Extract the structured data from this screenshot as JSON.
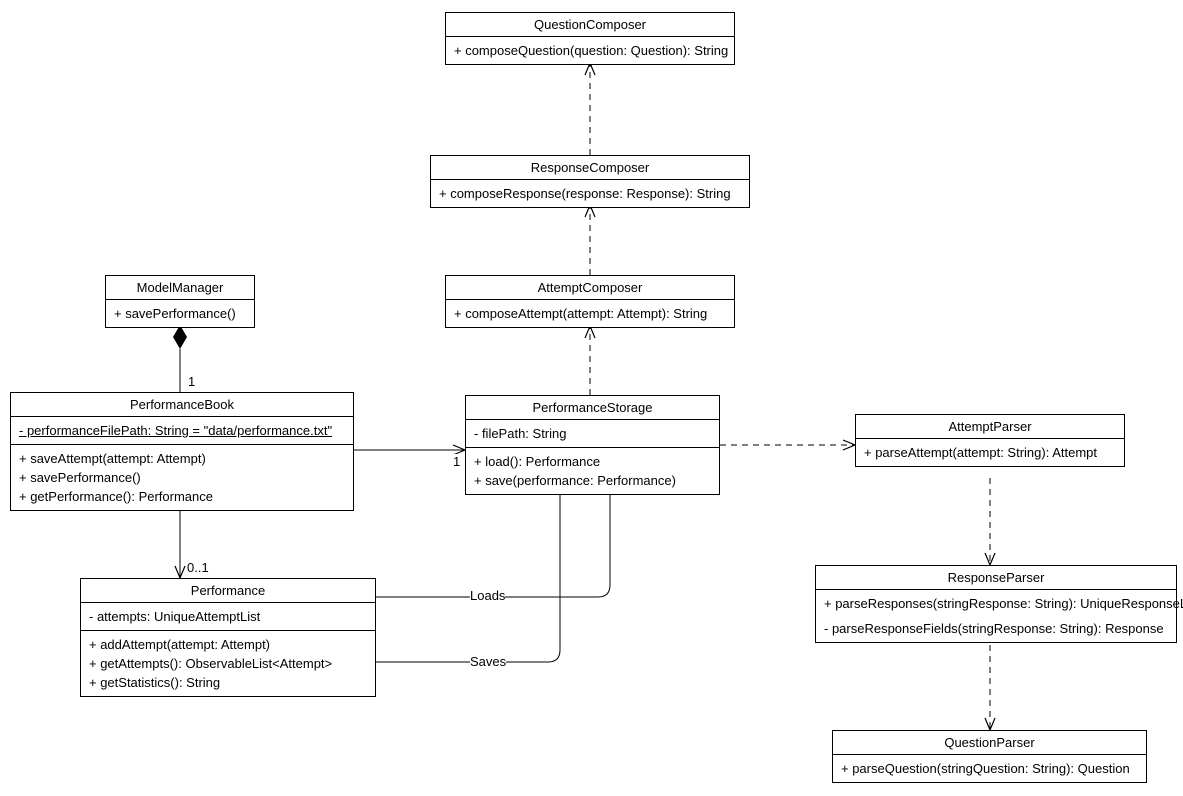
{
  "classes": {
    "question_composer": {
      "name": "QuestionComposer",
      "ops": [
        "+ composeQuestion(question: Question): String"
      ]
    },
    "response_composer": {
      "name": "ResponseComposer",
      "ops": [
        "+ composeResponse(response: Response): String"
      ]
    },
    "attempt_composer": {
      "name": "AttemptComposer",
      "ops": [
        "+ composeAttempt(attempt: Attempt): String"
      ]
    },
    "model_manager": {
      "name": "ModelManager",
      "ops": [
        "+ savePerformance()"
      ]
    },
    "performance_book": {
      "name": "PerformanceBook",
      "attrs": [
        "- performanceFilePath: String = \"data/performance.txt\""
      ],
      "ops": [
        "+ saveAttempt(attempt: Attempt)",
        "+ savePerformance()",
        "+ getPerformance(): Performance"
      ]
    },
    "performance_storage": {
      "name": "PerformanceStorage",
      "attrs": [
        "- filePath: String"
      ],
      "ops": [
        "+ load(): Performance",
        "+ save(performance: Performance)"
      ]
    },
    "attempt_parser": {
      "name": "AttemptParser",
      "ops": [
        "+ parseAttempt(attempt: String): Attempt"
      ]
    },
    "performance": {
      "name": "Performance",
      "attrs": [
        "- attempts: UniqueAttemptList"
      ],
      "ops": [
        "+ addAttempt(attempt: Attempt)",
        "+ getAttempts(): ObservableList<Attempt>",
        "+ getStatistics(): String"
      ]
    },
    "response_parser": {
      "name": "ResponseParser",
      "ops": [
        "+ parseResponses(stringResponse: String): UniqueResponseList",
        "- parseResponseFields(stringResponse: String): Response"
      ]
    },
    "question_parser": {
      "name": "QuestionParser",
      "ops": [
        "+ parseQuestion(stringQuestion: String): Question"
      ]
    }
  },
  "labels": {
    "mult_one_a": "1",
    "mult_one_b": "1",
    "mult_zero_one": "0..1",
    "loads": "Loads",
    "saves": "Saves"
  }
}
